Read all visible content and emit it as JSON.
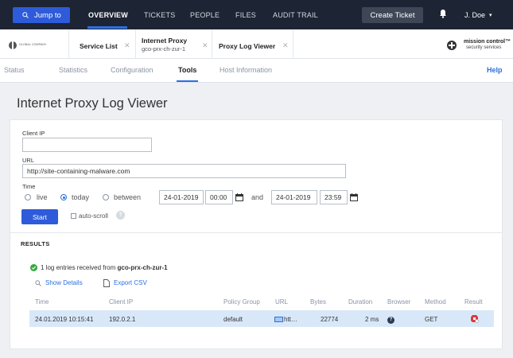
{
  "topbar": {
    "jump_label": "Jump to",
    "nav": [
      "OVERVIEW",
      "TICKETS",
      "PEOPLE",
      "FILES",
      "AUDIT TRAIL"
    ],
    "create_label": "Create Ticket",
    "user": "J. Doe",
    "colors": {
      "bar": "#1d2433",
      "accent": "#2d5bd9"
    }
  },
  "tabs": {
    "company": "GLOBAL COMPANY",
    "service_list": "Service List",
    "doc1_title": "Internet Proxy",
    "doc1_sub": "gco-prx-ch-zur-1",
    "doc2_title": "Proxy Log Viewer",
    "mc_line1": "mission control™",
    "mc_line2": "security services"
  },
  "subnav": {
    "items": [
      "Status",
      "Statistics",
      "Configuration",
      "Tools",
      "Host Information"
    ],
    "active": "Tools",
    "help": "Help"
  },
  "page": {
    "title": "Internet Proxy Log Viewer"
  },
  "form": {
    "client_ip_label": "Client IP",
    "client_ip_value": "",
    "url_label": "URL",
    "url_value": "http://site-containing-malware.com",
    "time_label": "Time",
    "radio_live": "live",
    "radio_today": "today",
    "radio_between": "between",
    "selected": "today",
    "from_date": "24-01-2019",
    "from_time": "00:00",
    "and_label": "and",
    "to_date": "24-01-2019",
    "to_time": "23:59",
    "start_label": "Start",
    "autoscroll_label": "auto-scroll",
    "autoscroll_checked": false
  },
  "results": {
    "heading": "RESULTS",
    "summary_prefix": "1 log entries received from ",
    "summary_host": "gco-prx-ch-zur-1",
    "show_details": "Show Details",
    "export_csv": "Export CSV",
    "columns": [
      "Time",
      "Client IP",
      "Policy Group",
      "URL",
      "Bytes",
      "Duration",
      "Browser",
      "Method",
      "Result"
    ],
    "rows": [
      {
        "time": "24.01.2019 10:15:41",
        "client_ip": "192.0.2.1",
        "policy_group": "default",
        "url": "htt…",
        "bytes": "22774",
        "duration": "2 ms",
        "browser": "?",
        "method": "GET",
        "result": "blocked-icon"
      }
    ]
  }
}
